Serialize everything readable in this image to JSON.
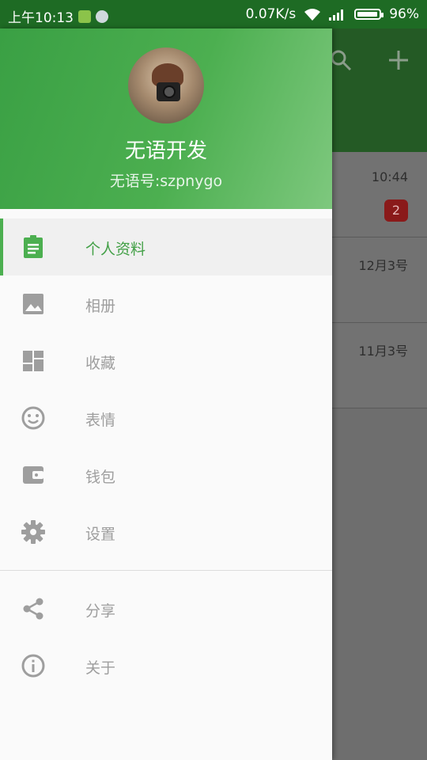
{
  "status_bar": {
    "time": "上午10:13",
    "net_speed": "0.07K/s",
    "battery": "96%"
  },
  "background": {
    "rows": [
      {
        "time": "10:44",
        "badge": "2"
      },
      {
        "time": "12月3号",
        "badge": ""
      },
      {
        "time": "11月3号",
        "badge": ""
      }
    ]
  },
  "drawer": {
    "name": "无语开发",
    "account": "无语号:szpnygo",
    "menu": [
      {
        "label": "个人资料",
        "icon": "assignment-icon"
      },
      {
        "label": "相册",
        "icon": "image-icon"
      },
      {
        "label": "收藏",
        "icon": "dashboard-icon"
      },
      {
        "label": "表情",
        "icon": "smiley-icon"
      },
      {
        "label": "钱包",
        "icon": "wallet-icon"
      },
      {
        "label": "设置",
        "icon": "gear-icon"
      }
    ],
    "secondary": [
      {
        "label": "分享",
        "icon": "share-icon"
      },
      {
        "label": "关于",
        "icon": "info-icon"
      }
    ],
    "accent": "#4caf50",
    "icon_color": "#9e9e9e"
  }
}
